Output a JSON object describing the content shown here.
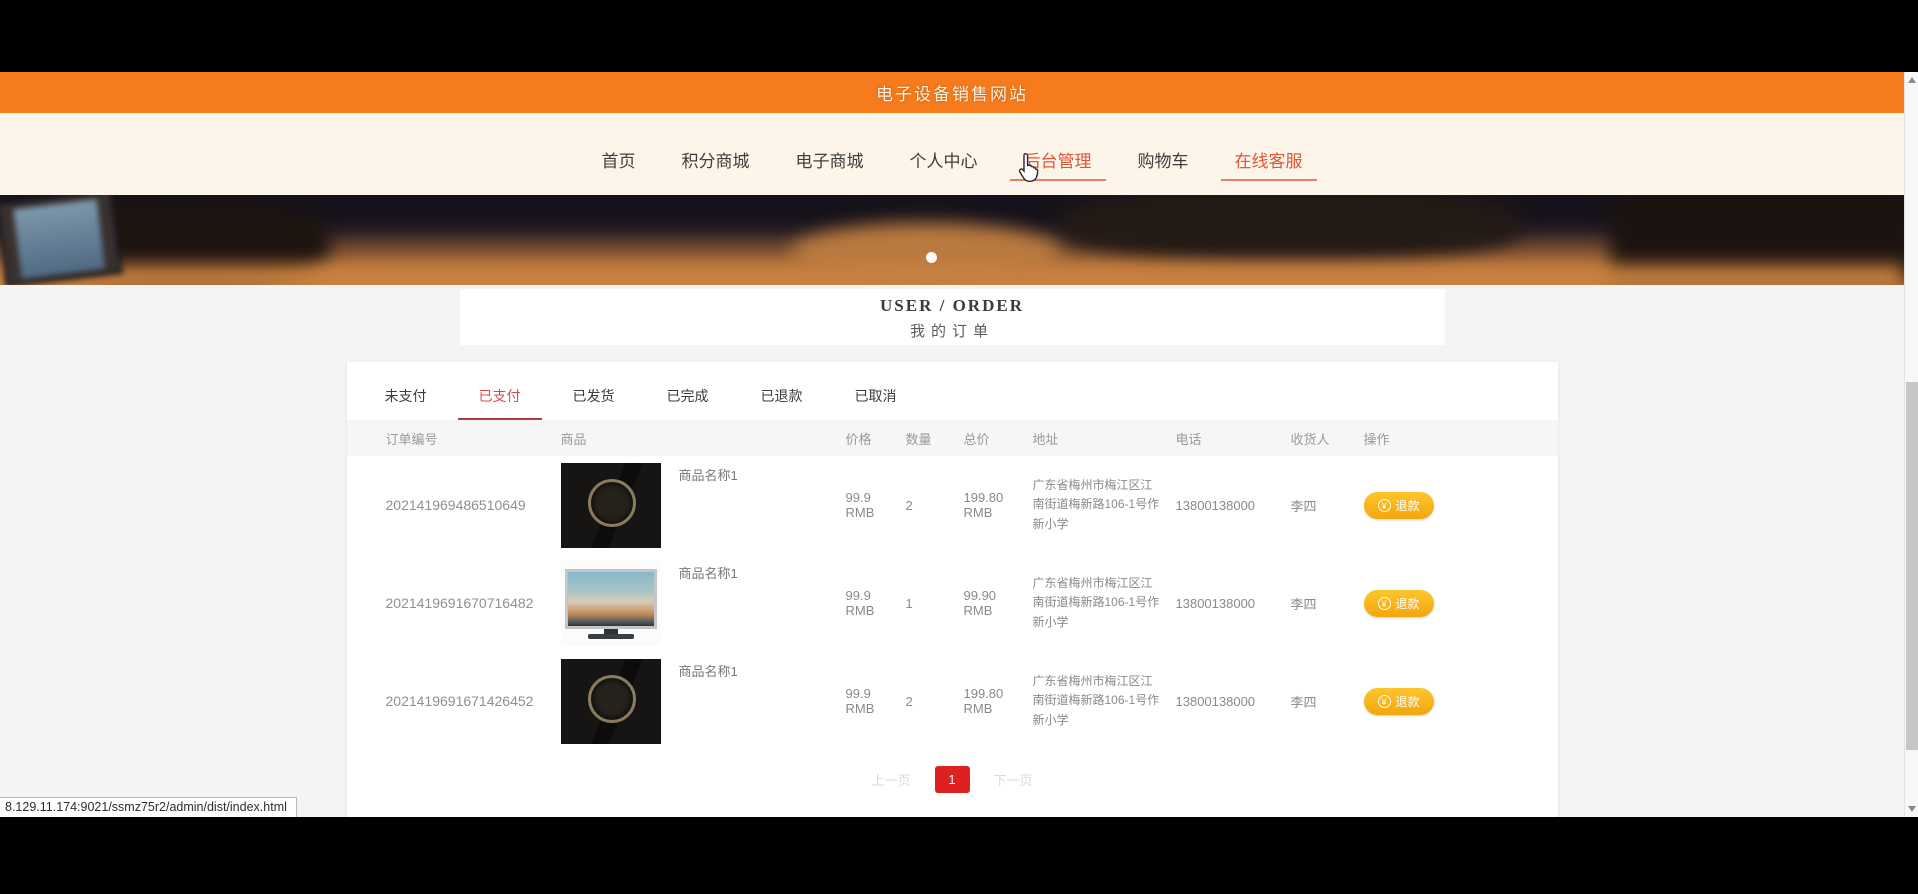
{
  "browser": {
    "status_link": "8.129.11.174:9021/ssmz75r2/admin/dist/index.html"
  },
  "header": {
    "title": "电子设备销售网站"
  },
  "nav": {
    "items": [
      {
        "label": "首页",
        "highlighted": false
      },
      {
        "label": "积分商城",
        "highlighted": false
      },
      {
        "label": "电子商城",
        "highlighted": false
      },
      {
        "label": "个人中心",
        "highlighted": false
      },
      {
        "label": "后台管理",
        "highlighted": true
      },
      {
        "label": "购物车",
        "highlighted": false
      },
      {
        "label": "在线客服",
        "highlighted": true
      }
    ]
  },
  "banner": {
    "carousel_dots": 1
  },
  "heading": {
    "title_en": "USER / ORDER",
    "title_zh": "我的订单"
  },
  "tabs": [
    {
      "label": "未支付",
      "active": false
    },
    {
      "label": "已支付",
      "active": true
    },
    {
      "label": "已发货",
      "active": false
    },
    {
      "label": "已完成",
      "active": false
    },
    {
      "label": "已退款",
      "active": false
    },
    {
      "label": "已取消",
      "active": false
    }
  ],
  "orders": {
    "headers": [
      "订单编号",
      "商品",
      "价格",
      "数量",
      "总价",
      "地址",
      "电话",
      "收货人",
      "操作"
    ],
    "action": {
      "label": "退款",
      "icon": "coin-icon",
      "glyph": "¥"
    },
    "rows": [
      {
        "order_no": "202141969486510649",
        "product_name": "商品名称1",
        "product_image": "watch",
        "price": "99.9 RMB",
        "quantity": "2",
        "total": "199.80 RMB",
        "address": "广东省梅州市梅江区江南街道梅新路106-1号作新小学",
        "phone": "13800138000",
        "recipient": "李四"
      },
      {
        "order_no": "2021419691670716482",
        "product_name": "商品名称1",
        "product_image": "tv",
        "price": "99.9 RMB",
        "quantity": "1",
        "total": "99.90 RMB",
        "address": "广东省梅州市梅江区江南街道梅新路106-1号作新小学",
        "phone": "13800138000",
        "recipient": "李四"
      },
      {
        "order_no": "2021419691671426452",
        "product_name": "商品名称1",
        "product_image": "watch",
        "price": "99.9 RMB",
        "quantity": "2",
        "total": "199.80 RMB",
        "address": "广东省梅州市梅江区江南街道梅新路106-1号作新小学",
        "phone": "13800138000",
        "recipient": "李四"
      }
    ]
  },
  "pagination": {
    "prev": "上一页",
    "current": "1",
    "next": "下一页"
  },
  "colors": {
    "header_orange": "#f57b1d",
    "nav_bg": "#fdf4ea",
    "nav_highlight_red": "#e05636",
    "tab_active_red": "#d24d4d",
    "tab_underline_maroon": "#ab3f3f",
    "action_button_yellow": "#f8b416",
    "pagination_red": "#dd2020"
  }
}
